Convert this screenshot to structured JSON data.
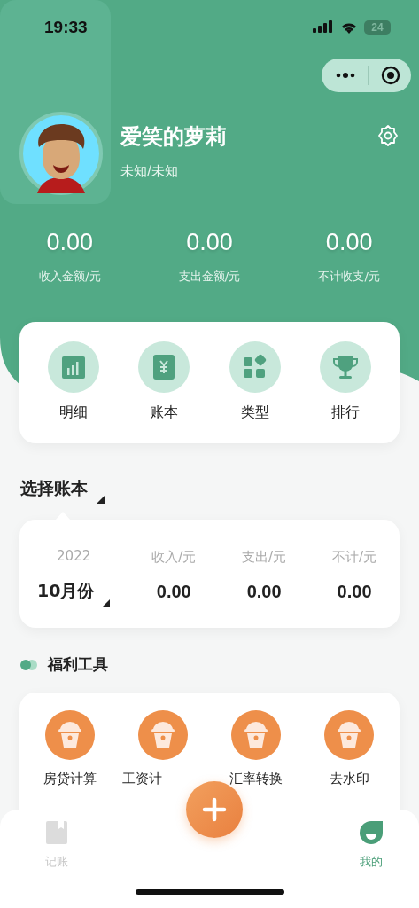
{
  "status_bar": {
    "time": "19:33",
    "battery": "24"
  },
  "profile": {
    "name": "爱笑的萝莉",
    "subtitle": "未知/未知"
  },
  "summary": [
    {
      "value": "0.00",
      "label": "收入金额/元"
    },
    {
      "value": "0.00",
      "label": "支出金额/元"
    },
    {
      "value": "0.00",
      "label": "不计收支/元"
    }
  ],
  "shortcuts": [
    {
      "kind": "chart",
      "label": "明细"
    },
    {
      "kind": "ledger",
      "label": "账本"
    },
    {
      "kind": "grid",
      "label": "类型"
    },
    {
      "kind": "trophy",
      "label": "排行"
    }
  ],
  "book_selector": {
    "label": "选择账本"
  },
  "month_card": {
    "year": "2022",
    "month": "10月份",
    "columns": [
      {
        "label": "收入/元",
        "value": "0.00"
      },
      {
        "label": "支出/元",
        "value": "0.00"
      },
      {
        "label": "不计/元",
        "value": "0.00"
      }
    ]
  },
  "tools": {
    "title": "福利工具",
    "items": [
      {
        "label": "房贷计算"
      },
      {
        "label": "工资计"
      },
      {
        "label": "汇率转换"
      },
      {
        "label": "去水印"
      }
    ]
  },
  "tab_bar": [
    {
      "kind": "book",
      "label": "记账",
      "selected": false
    },
    {
      "kind": "add"
    },
    {
      "kind": "me",
      "label": "我的",
      "selected": true
    }
  ]
}
